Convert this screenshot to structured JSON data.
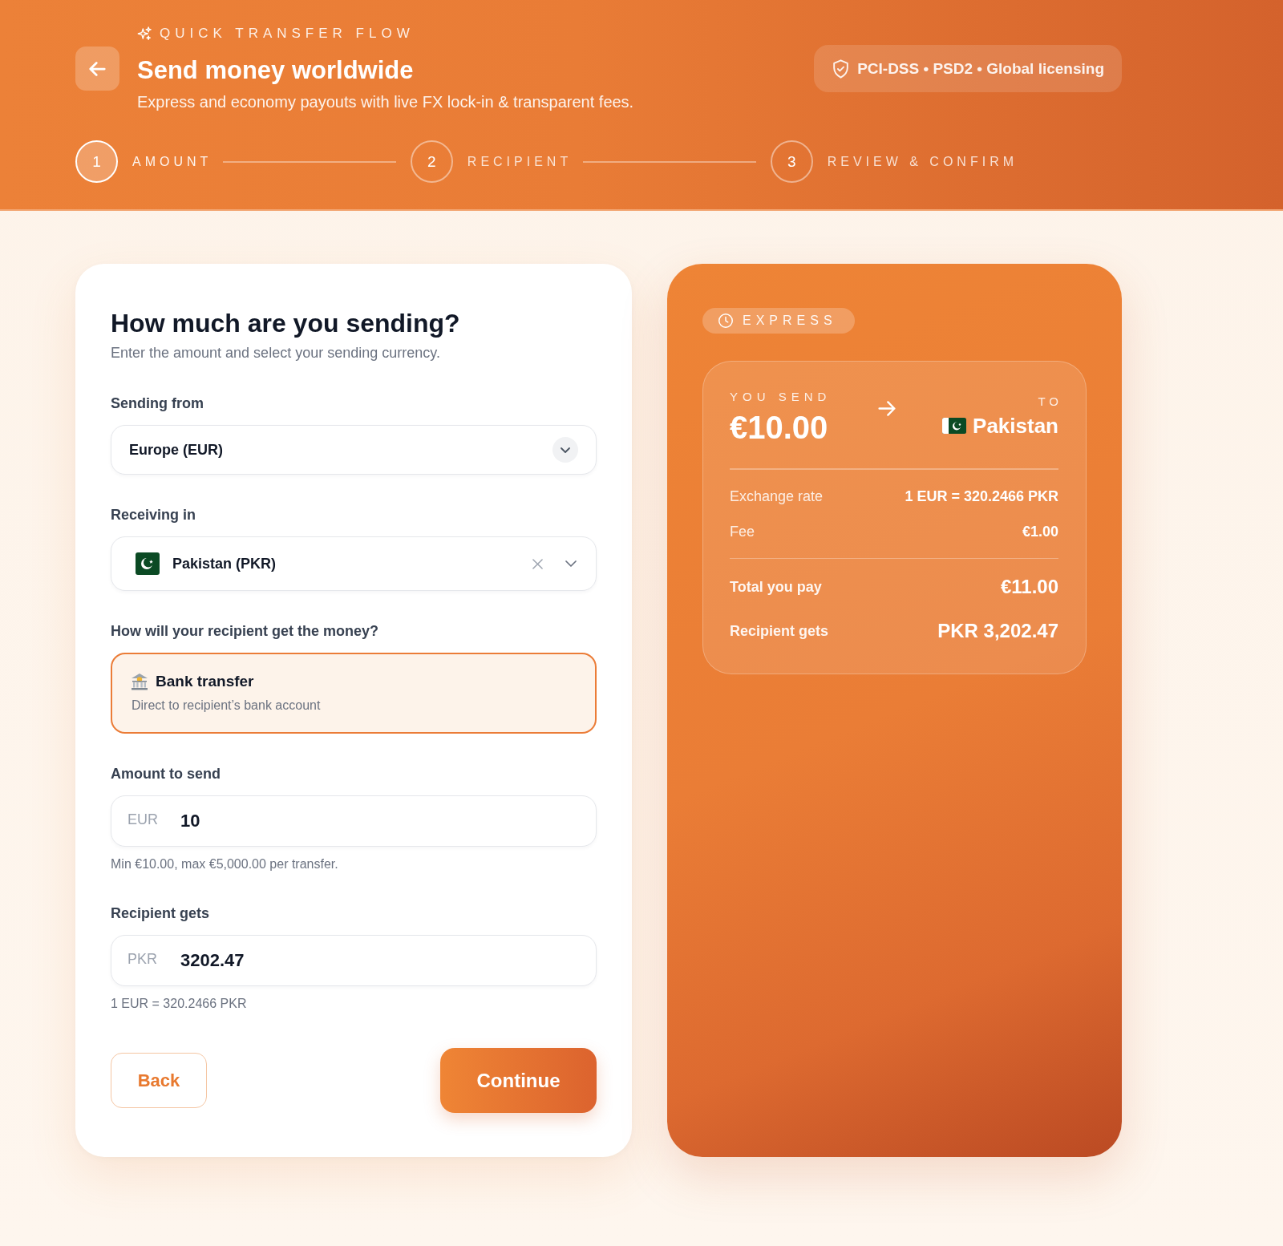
{
  "header": {
    "eyebrow": "QUICK TRANSFER FLOW",
    "title": "Send money worldwide",
    "subtitle": "Express and economy payouts with live FX lock-in & transparent fees.",
    "badge": "PCI-DSS • PSD2 • Global licensing"
  },
  "steps": [
    {
      "number": "1",
      "label": "AMOUNT",
      "selected": true
    },
    {
      "number": "2",
      "label": "RECIPIENT",
      "selected": false
    },
    {
      "number": "3",
      "label": "REVIEW & CONFIRM",
      "selected": false
    }
  ],
  "form": {
    "title": "How much are you sending?",
    "subtitle": "Enter the amount and select your sending currency.",
    "sections": [
      {
        "kind": "select",
        "label": "Sending from",
        "value": "Europe (EUR)"
      },
      {
        "kind": "country-select",
        "label": "Receiving in",
        "value": "Pakistan (PKR)"
      },
      {
        "kind": "options",
        "label": "How will your recipient get the money?",
        "options": [
          {
            "title": "Bank transfer",
            "description": "Direct to recipient’s bank account",
            "selected": true
          }
        ]
      },
      {
        "kind": "amount",
        "label": "Amount to send",
        "currency": "EUR",
        "value": "10",
        "hint": "Min €10.00, max €5,000.00 per transfer."
      },
      {
        "kind": "amount",
        "label": "Recipient gets",
        "currency": "PKR",
        "value": "3202.47",
        "hint": "1 EUR = 320.2466 PKR"
      }
    ],
    "actions": [
      {
        "kind": "secondary",
        "label": "Back"
      },
      {
        "kind": "primary",
        "label": "Continue"
      }
    ]
  },
  "summary": {
    "tier": "EXPRESS",
    "send_label": "YOU SEND",
    "send_amount": "€10.00",
    "to_label": "TO",
    "to_country": "Pakistan",
    "rows": [
      {
        "kind": "detail",
        "label": "Exchange rate",
        "value": "1 EUR = 320.2466 PKR"
      },
      {
        "kind": "detail",
        "label": "Fee",
        "value": "€1.00"
      },
      {
        "kind": "total",
        "label": "Total you pay",
        "value": "€11.00"
      },
      {
        "kind": "total",
        "label": "Recipient gets",
        "value": "PKR 3,202.47"
      }
    ]
  }
}
